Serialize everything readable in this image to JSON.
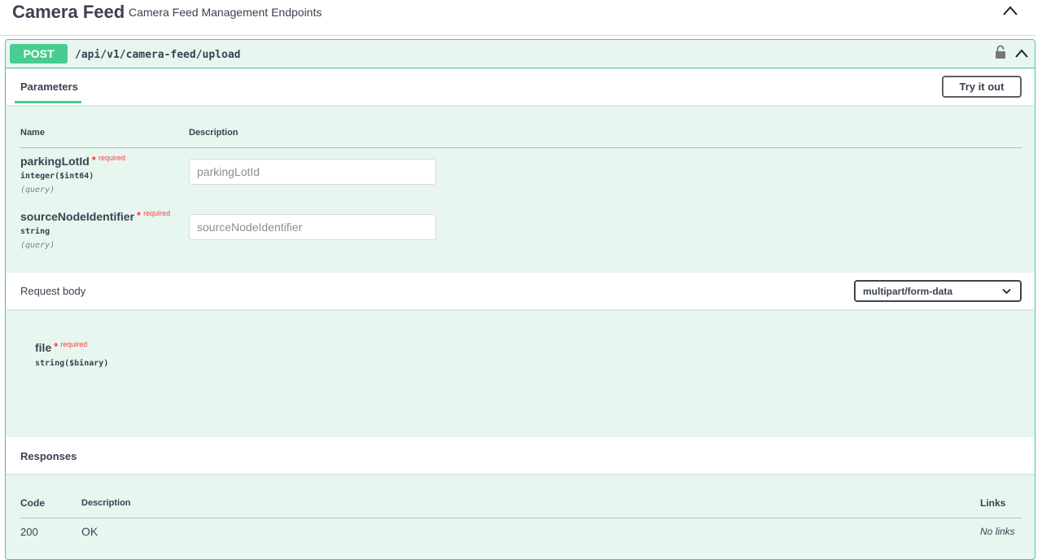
{
  "tag": {
    "title": "Camera Feed",
    "description": "Camera Feed Management Endpoints"
  },
  "operation": {
    "method": "POST",
    "path": "/api/v1/camera-feed/upload"
  },
  "parameters": {
    "tab_label": "Parameters",
    "try_button": "Try it out",
    "col_name": "Name",
    "col_description": "Description",
    "items": [
      {
        "name": "parkingLotId",
        "star": "*",
        "required": "required",
        "type": "integer($int64)",
        "in": "(query)",
        "placeholder": "parkingLotId"
      },
      {
        "name": "sourceNodeIdentifier",
        "star": "*",
        "required": "required",
        "type": "string",
        "in": "(query)",
        "placeholder": "sourceNodeIdentifier"
      }
    ]
  },
  "request_body": {
    "label": "Request body",
    "content_type": "multipart/form-data",
    "field": {
      "name": "file",
      "star": "*",
      "required": "required",
      "type": "string($binary)"
    }
  },
  "responses": {
    "label": "Responses",
    "col_code": "Code",
    "col_description": "Description",
    "col_links": "Links",
    "rows": [
      {
        "code": "200",
        "description": "OK",
        "links": "No links"
      }
    ]
  },
  "colors": {
    "post_green": "#49cc90",
    "post_bg": "#e8f6f0",
    "required_red": "#f93e3e",
    "text": "#3b4151"
  }
}
